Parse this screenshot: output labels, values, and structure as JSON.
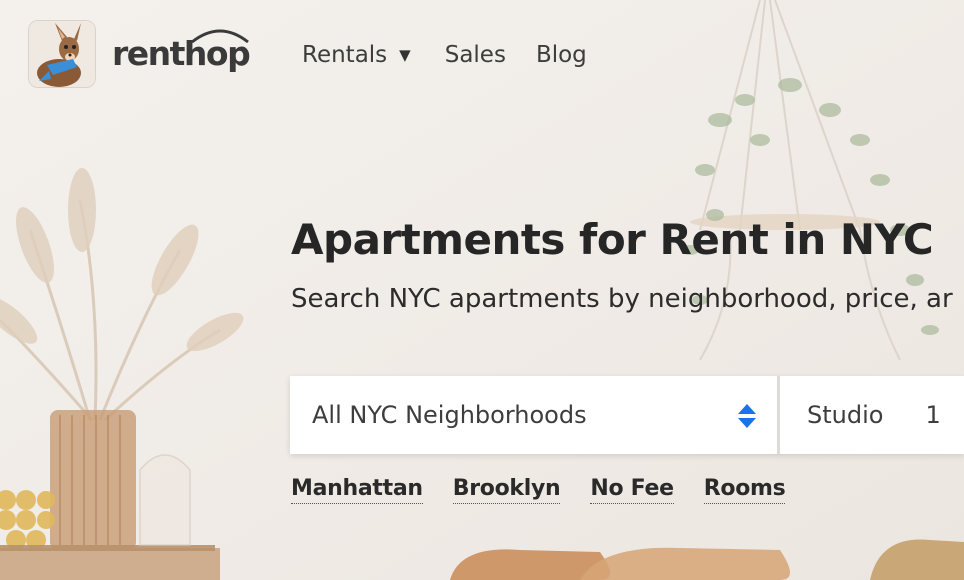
{
  "header": {
    "logo_text": "renthop",
    "nav": [
      {
        "label": "Rentals",
        "has_dropdown": true
      },
      {
        "label": "Sales"
      },
      {
        "label": "Blog"
      }
    ]
  },
  "hero": {
    "title": "Apartments for Rent in NYC",
    "subtitle": "Search NYC apartments by neighborhood, price, ar"
  },
  "search": {
    "neighborhood_value": "All NYC Neighborhoods",
    "bed_options": [
      "Studio",
      "1"
    ]
  },
  "quick_links": [
    "Manhattan",
    "Brooklyn",
    "No Fee",
    "Rooms"
  ],
  "colors": {
    "background": "#f1ede9",
    "text_dark": "#262626",
    "select_arrow_blue": "#1a73e8"
  }
}
